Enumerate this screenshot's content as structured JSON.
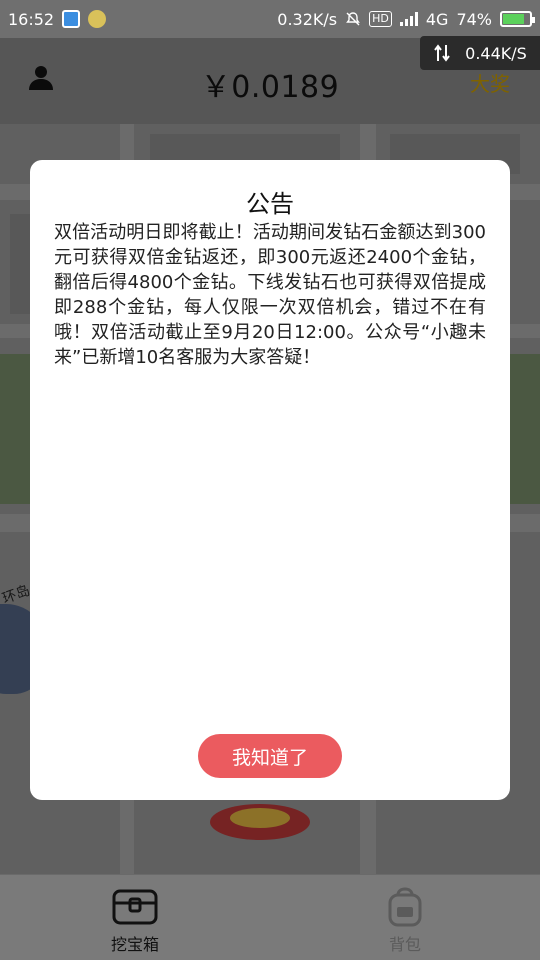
{
  "status_bar": {
    "time": "16:52",
    "net_speed": "0.32K/s",
    "hd": "HD",
    "network": "4G",
    "battery": "74%"
  },
  "speed_overlay": {
    "speed": "0.44K/S",
    "icon": "swap-vert-icon"
  },
  "header": {
    "balance": "￥0.0189",
    "prize_label": "大奖",
    "user_icon": "user-icon"
  },
  "map": {
    "road_label": "环岛"
  },
  "modal": {
    "title": "公告",
    "body": "双倍活动明日即将截止！活动期间发钻石金额达到300元可获得双倍金钻返还，即300元返还2400个金钻，翻倍后得4800个金钻。下线发钻石也可获得双倍提成即288个金钻，每人仅限一次双倍机会，错过不在有哦！双倍活动截止至9月20日12:00。公众号“小趣未来”已新增10名客服为大家答疑！",
    "ok_label": "我知道了"
  },
  "bottom_nav": {
    "items": [
      {
        "label": "挖宝箱",
        "icon": "treasure-chest-icon",
        "active": true
      },
      {
        "label": "背包",
        "icon": "backpack-icon",
        "active": false
      }
    ]
  },
  "colors": {
    "accent": "#eb5b5f",
    "prize": "#b58d00",
    "battery": "#5cd15c"
  }
}
